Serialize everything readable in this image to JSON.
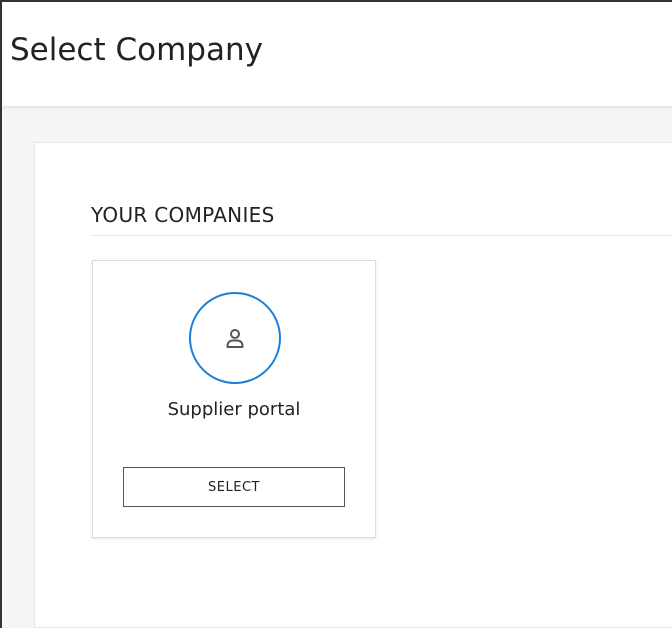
{
  "header": {
    "title": "Select Company"
  },
  "section": {
    "heading": "YOUR COMPANIES"
  },
  "companies": [
    {
      "name": "Supplier portal",
      "icon": "user-icon",
      "select_label": "SELECT"
    }
  ],
  "colors": {
    "accent": "#1a7fd6",
    "page_background": "#f5f5f5",
    "card_background": "#ffffff",
    "text": "#222222"
  }
}
